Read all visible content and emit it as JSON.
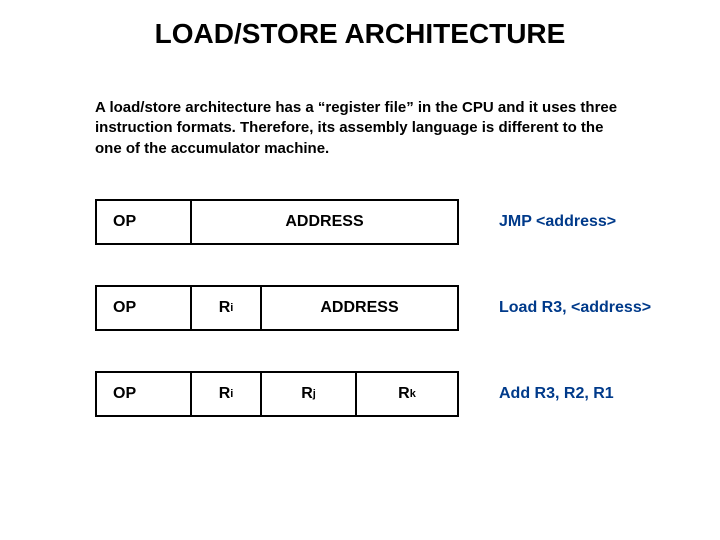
{
  "title": "LOAD/STORE ARCHITECTURE",
  "description": "A load/store architecture has a “register file” in the CPU and it uses three instruction formats. Therefore, its assembly language is different to the one of the accumulator machine.",
  "rows": {
    "r1": {
      "op": "OP",
      "addr": "ADDRESS",
      "example": "JMP <address>"
    },
    "r2": {
      "op": "OP",
      "ri_base": "R",
      "ri_sub": "i",
      "addr": "ADDRESS",
      "example": "Load R3, <address>"
    },
    "r3": {
      "op": "OP",
      "ri_base": "R",
      "ri_sub": "i",
      "rj_base": "R",
      "rj_sub": "j",
      "rk_base": "R",
      "rk_sub": "k",
      "example": "Add R3, R2, R1"
    }
  }
}
